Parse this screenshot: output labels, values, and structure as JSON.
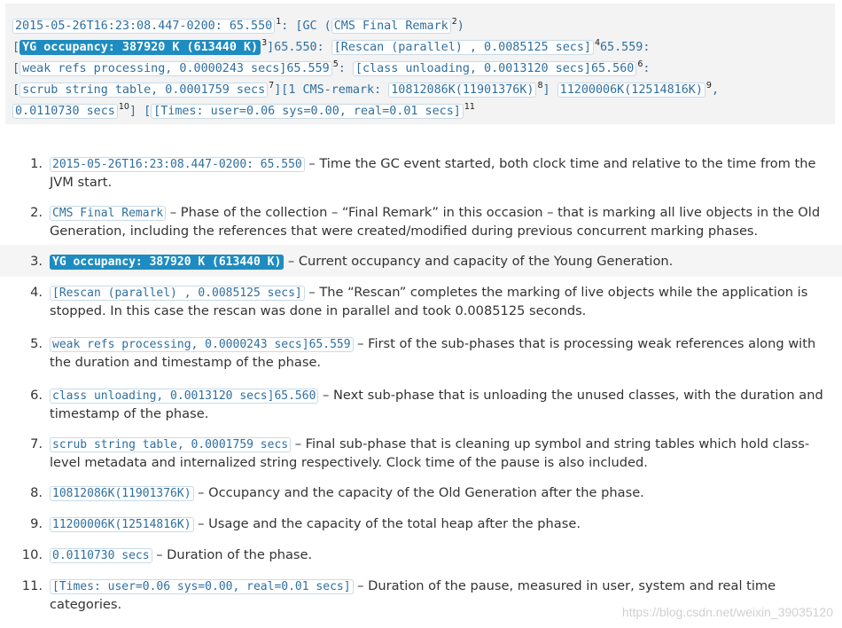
{
  "log": {
    "line1": {
      "ts": "2015-05-26T16:23:08.447-0200: 65.550",
      "sup1": "1",
      "mid": ": [GC (",
      "remark": "CMS Final Remark",
      "sup2": "2",
      "end": ")"
    },
    "line2": {
      "open": "[",
      "yg": "YG occupancy: 387920 K (613440 K)",
      "sup3": "3",
      "mid": "]65.550: ",
      "rescan": "[Rescan (parallel) , 0.0085125 secs]",
      "sup4": "4",
      "end": "65.559:"
    },
    "line3": {
      "open": "[",
      "weak": "weak refs processing, 0.0000243 secs]65.559",
      "sup5": "5",
      "mid": ": ",
      "cls": "[class unloading, 0.0013120 secs]65.560",
      "sup6": "6",
      "end": ":"
    },
    "line4": {
      "open": "[",
      "scrub": "scrub string table, 0.0001759 secs",
      "sup7": "7",
      "mid": "][1 CMS-remark: ",
      "old": "10812086K(11901376K)",
      "sup8": "8",
      "mid2": "] ",
      "heap": "11200006K(12514816K)",
      "sup9": "9",
      "end": ","
    },
    "line5": {
      "dur": "0.0110730 secs",
      "sup10": "10",
      "mid": "] [",
      "times": "[Times: user=0.06 sys=0.00, real=0.01 secs]",
      "sup11": "11"
    }
  },
  "items": [
    {
      "num": "1.",
      "code": "2015-05-26T16:23:08.447-0200: 65.550",
      "text": " – Time the GC event started, both clock time and relative to the time from the JVM start."
    },
    {
      "num": "2.",
      "code": "CMS Final Remark",
      "text": " – Phase of the collection – “Final Remark” in this occasion – that is marking all live objects in the Old Generation, including the references that were created/modified during previous concurrent marking phases."
    },
    {
      "num": "3.",
      "code": "YG occupancy: 387920 K (613440 K)",
      "text": " – Current occupancy and capacity of the Young Generation."
    },
    {
      "num": "4.",
      "code": "[Rescan (parallel) , 0.0085125 secs]",
      "text": " – The “Rescan” completes the marking of live objects while the application is stopped. In this case the rescan was done in parallel and took 0.0085125 seconds."
    },
    {
      "num": "5.",
      "code": "weak refs processing, 0.0000243 secs]65.559",
      "text": " – First of the sub-phases that is processing weak references along with the duration and timestamp of the phase."
    },
    {
      "num": "6.",
      "code": "class unloading, 0.0013120 secs]65.560",
      "text": " – Next sub-phase that is unloading the unused classes, with the duration and timestamp of the phase."
    },
    {
      "num": "7.",
      "code": "scrub string table, 0.0001759 secs",
      "text": " – Final sub-phase that is cleaning up symbol and string tables which hold class-level metadata and internalized string respectively. Clock time of the pause is also included."
    },
    {
      "num": "8.",
      "code": "10812086K(11901376K)",
      "text": " – Occupancy and the capacity of the Old Generation after the phase."
    },
    {
      "num": "9.",
      "code": "11200006K(12514816K)",
      "text": " – Usage and the capacity of the total heap after the phase."
    },
    {
      "num": "10.",
      "code": "0.0110730 secs",
      "text": " – Duration of the phase."
    },
    {
      "num": "11.",
      "code": "[Times: user=0.06 sys=0.00, real=0.01 secs]",
      "text": " – Duration of the pause, measured in user, system and real time categories."
    }
  ],
  "watermark": "https://blog.csdn.net/weixin_39035120"
}
